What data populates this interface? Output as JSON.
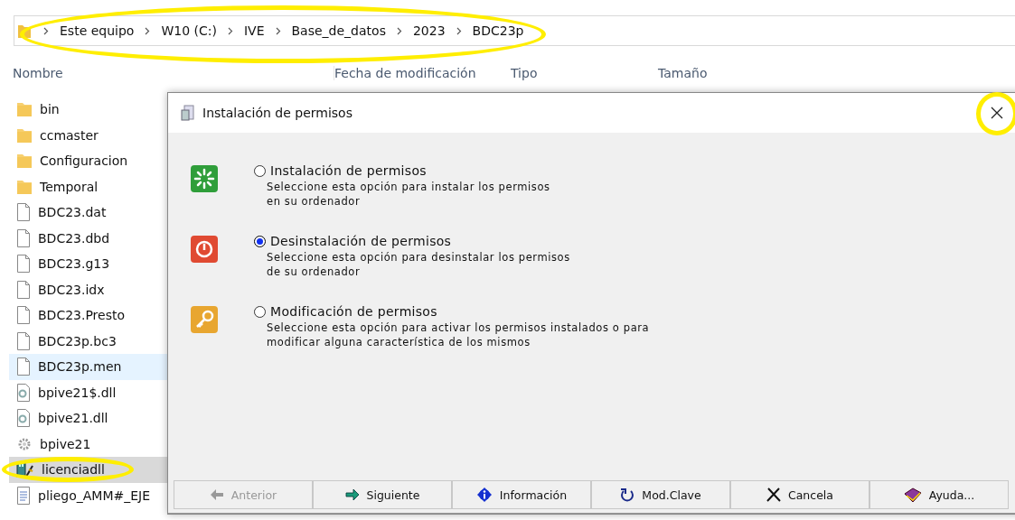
{
  "address_bar": {
    "crumbs": [
      "Este equipo",
      "W10 (C:)",
      "IVE",
      "Base_de_datos",
      "2023",
      "BDC23p"
    ]
  },
  "columns": [
    "Nombre",
    "Fecha de modificación",
    "Tipo",
    "Tamaño"
  ],
  "files": [
    {
      "name": "bin",
      "kind": "folder",
      "selected": false,
      "hovered": false
    },
    {
      "name": "ccmaster",
      "kind": "folder",
      "selected": false,
      "hovered": false
    },
    {
      "name": "Configuracion",
      "kind": "folder",
      "selected": false,
      "hovered": false
    },
    {
      "name": "Temporal",
      "kind": "folder",
      "selected": false,
      "hovered": false
    },
    {
      "name": "BDC23.dat",
      "kind": "file",
      "selected": false,
      "hovered": false
    },
    {
      "name": "BDC23.dbd",
      "kind": "file",
      "selected": false,
      "hovered": false
    },
    {
      "name": "BDC23.g13",
      "kind": "file",
      "selected": false,
      "hovered": false
    },
    {
      "name": "BDC23.idx",
      "kind": "file",
      "selected": false,
      "hovered": false
    },
    {
      "name": "BDC23.Presto",
      "kind": "file",
      "selected": false,
      "hovered": false
    },
    {
      "name": "BDC23p.bc3",
      "kind": "file",
      "selected": false,
      "hovered": false
    },
    {
      "name": "BDC23p.men",
      "kind": "file",
      "selected": false,
      "hovered": true
    },
    {
      "name": "bpive21$.dll",
      "kind": "dll",
      "selected": false,
      "hovered": false
    },
    {
      "name": "bpive21.dll",
      "kind": "dll",
      "selected": false,
      "hovered": false
    },
    {
      "name": "bpive21",
      "kind": "gear",
      "selected": false,
      "hovered": false
    },
    {
      "name": "licenciadll",
      "kind": "app",
      "selected": true,
      "hovered": false
    },
    {
      "name": "pliego_AMM#_EJE",
      "kind": "doc",
      "selected": false,
      "hovered": false
    }
  ],
  "dialog": {
    "title": "Instalación de permisos",
    "options": [
      {
        "kind": "install",
        "label": "Instalación de permisos",
        "description": "Seleccione esta opción para instalar los permisos\nen su ordenador",
        "selected": false
      },
      {
        "kind": "uninstall",
        "label": "Desinstalación de permisos",
        "description": "Seleccione esta opción para desinstalar los permisos\nde su ordenador",
        "selected": true
      },
      {
        "kind": "modify",
        "label": "Modificación de permisos",
        "description": "Seleccione esta opción para activar los permisos instalados o para\nmodificar alguna característica de los mismos",
        "selected": false
      }
    ],
    "buttons": [
      {
        "kind": "back",
        "label": "Anterior",
        "disabled": true
      },
      {
        "kind": "next",
        "label": "Siguiente",
        "disabled": false
      },
      {
        "kind": "info",
        "label": "Información",
        "disabled": false
      },
      {
        "kind": "key",
        "label": "Mod.Clave",
        "disabled": false
      },
      {
        "kind": "cancel",
        "label": "Cancela",
        "disabled": false
      },
      {
        "kind": "help",
        "label": "Ayuda...",
        "disabled": false
      }
    ]
  }
}
